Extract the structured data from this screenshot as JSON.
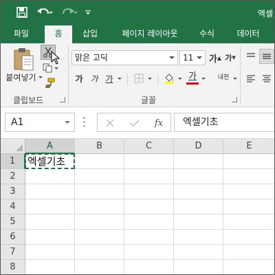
{
  "titlebar": {
    "title": "엑셀",
    "qat": {
      "save_icon": "save-icon",
      "undo_icon": "undo-icon",
      "redo_icon": "redo-icon",
      "customize_icon": "customize-qat-icon"
    }
  },
  "tabs": [
    {
      "label": "파일",
      "active": false
    },
    {
      "label": "홈",
      "active": true
    },
    {
      "label": "삽입",
      "active": false
    },
    {
      "label": "페이지 레이아웃",
      "active": false
    },
    {
      "label": "수식",
      "active": false
    },
    {
      "label": "데이터",
      "active": false
    }
  ],
  "ribbon": {
    "clipboard": {
      "paste_label": "붙여넣기",
      "group_label": "클립보드"
    },
    "font": {
      "font_name": "맑은 고딕",
      "font_size": "11",
      "bold": "가",
      "italic": "가",
      "underline": "가",
      "font_color_glyph": "가",
      "phonetic": "내천",
      "group_label": "글꼴"
    }
  },
  "formula_bar": {
    "name_box": "A1",
    "fx_label": "fx",
    "content": "엑셀기초"
  },
  "grid": {
    "columns": [
      "A",
      "B",
      "C",
      "D",
      "E"
    ],
    "rows": [
      "1",
      "2",
      "3",
      "4",
      "5",
      "6",
      "7",
      "8"
    ],
    "selected_column": "A",
    "selected_row": "1",
    "cells": {
      "A1": "엑셀기초"
    }
  },
  "colors": {
    "accent": "#217346",
    "font_color_bar": "#e00000"
  }
}
